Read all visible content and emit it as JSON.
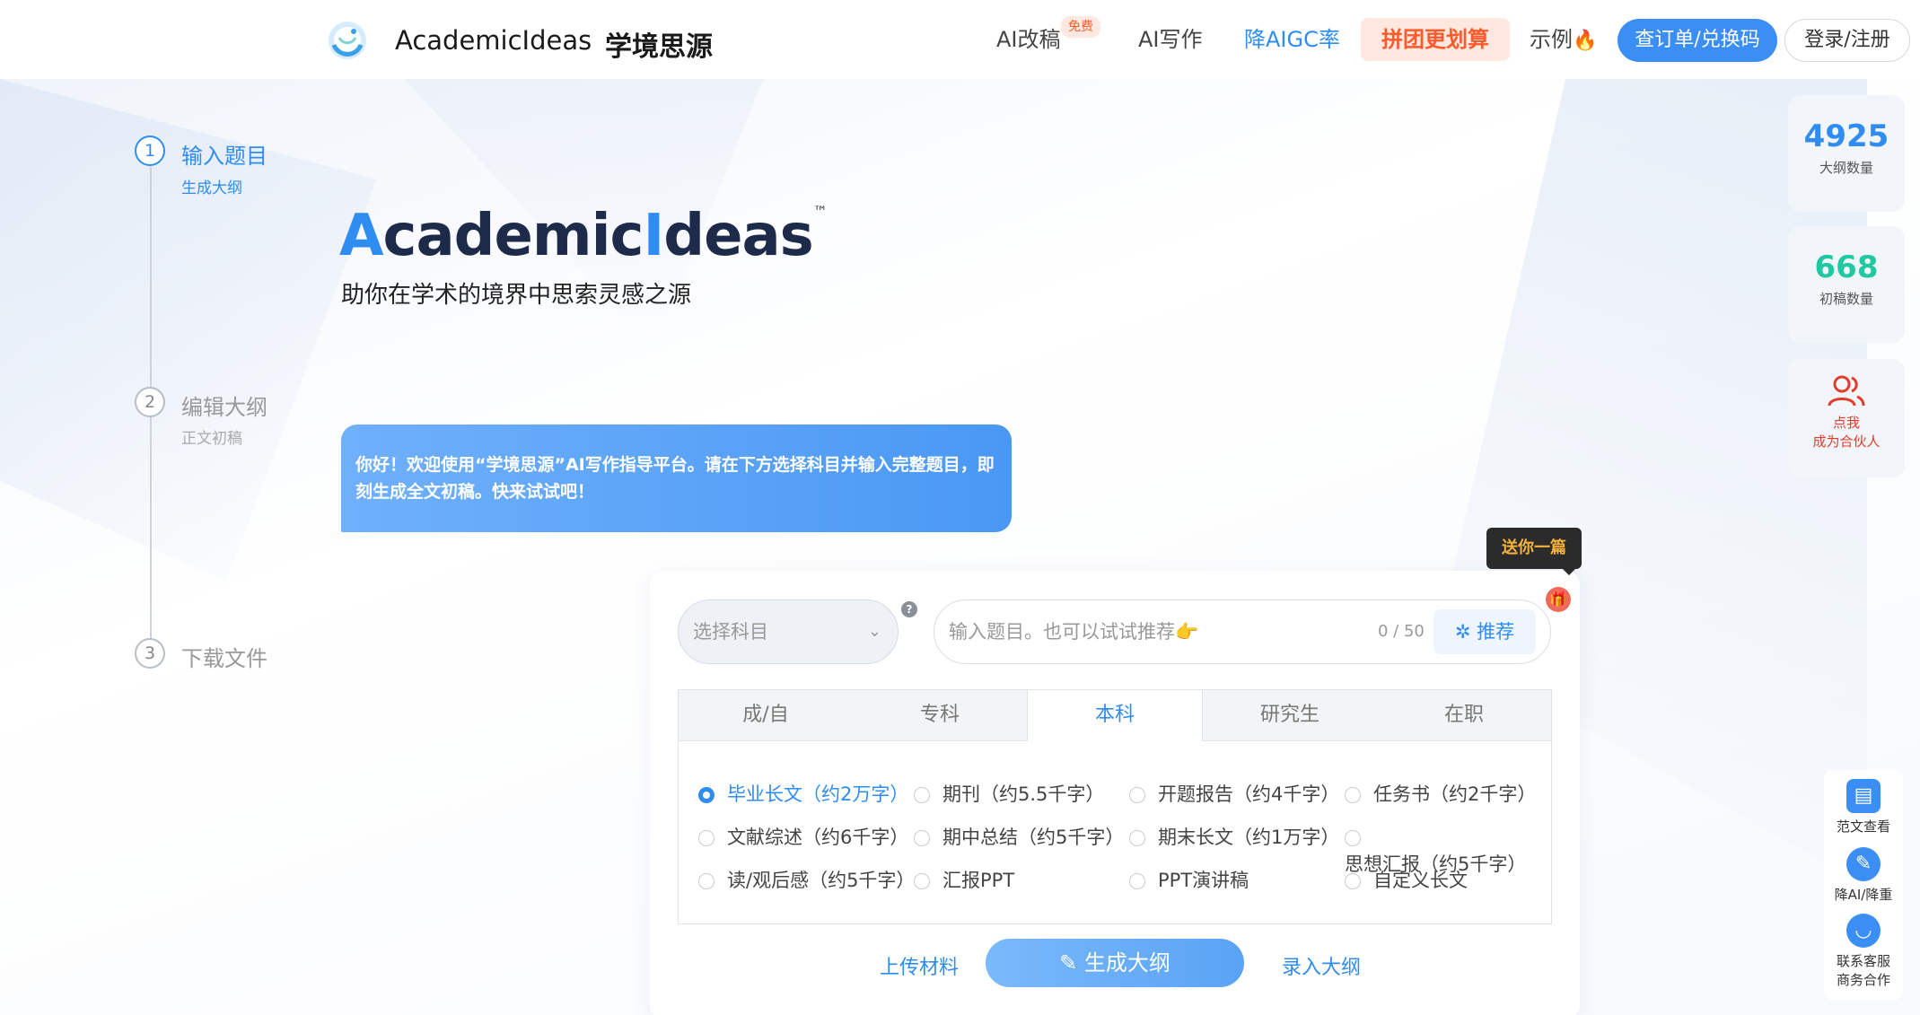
{
  "header": {
    "brand_en": "AcademicIdeas",
    "brand_cn": "学境思源",
    "nav": {
      "ai_revise": "AI改稿",
      "free_badge": "免费",
      "ai_write": "AI写作",
      "reduce_aigc": "降AIGC率",
      "group_buy": "拼团更划算",
      "example": "示例",
      "order_btn": "查订单/兑换码",
      "login_btn": "登录/注册"
    }
  },
  "steps": [
    {
      "num": "1",
      "title": "输入题目",
      "sub": "生成大纲"
    },
    {
      "num": "2",
      "title": "编辑大纲",
      "sub": "正文初稿"
    },
    {
      "num": "3",
      "title": "下载文件",
      "sub": ""
    }
  ],
  "hero": {
    "title_a": "A",
    "title_mid": "cademic",
    "title_i": "I",
    "title_end": "deas",
    "tm": "™",
    "subtitle": "助你在学术的境界中思索灵感之源",
    "bubble_text": "你好！欢迎使用“学境思源”AI写作指导平台。请在下方选择科目并输入完整题目，即刻生成全文初稿。快来试试吧！"
  },
  "form": {
    "tooltip": "送你一篇",
    "subject_placeholder": "选择科目",
    "topic_placeholder": "输入题目。也可以试试推荐👉",
    "counter": "0 / 50",
    "recommend_btn": "推荐",
    "tabs": [
      "成/自",
      "专科",
      "本科",
      "研究生",
      "在职"
    ],
    "active_tab": "本科",
    "options": [
      {
        "label": "毕业长文（约2万字）",
        "checked": true
      },
      {
        "label": "期刊（约5.5千字）",
        "checked": false
      },
      {
        "label": "开题报告（约4千字）",
        "checked": false
      },
      {
        "label": "任务书（约2千字）",
        "checked": false
      },
      {
        "label": "文献综述（约6千字）",
        "checked": false
      },
      {
        "label": "期中总结（约5千字）",
        "checked": false
      },
      {
        "label": "期末长文（约1万字）",
        "checked": false
      },
      {
        "label": "思想汇报（约5千字）",
        "checked": false
      },
      {
        "label": "读/观后感（约5千字）",
        "checked": false
      },
      {
        "label": "汇报PPT",
        "checked": false
      },
      {
        "label": "PPT演讲稿",
        "checked": false
      },
      {
        "label": "自定义长文",
        "checked": false
      }
    ],
    "upload_link": "上传材料",
    "generate_btn": "生成大纲",
    "import_link": "录入大纲"
  },
  "sidebar": {
    "outline_count": "4925",
    "outline_label": "大纲数量",
    "draft_count": "668",
    "draft_label": "初稿数量",
    "partner_line1": "点我",
    "partner_line2": "成为合伙人",
    "tools": [
      {
        "label": "范文查看"
      },
      {
        "label": "降AI/降重"
      },
      {
        "label": "联系客服",
        "label2": "商务合作"
      }
    ]
  },
  "colors": {
    "primary": "#2f8cf0",
    "accent_orange": "#ff5a2c",
    "stat_outline": "#2f8cf0",
    "stat_draft": "#22c9a0",
    "partner_red": "#e23c2c"
  }
}
